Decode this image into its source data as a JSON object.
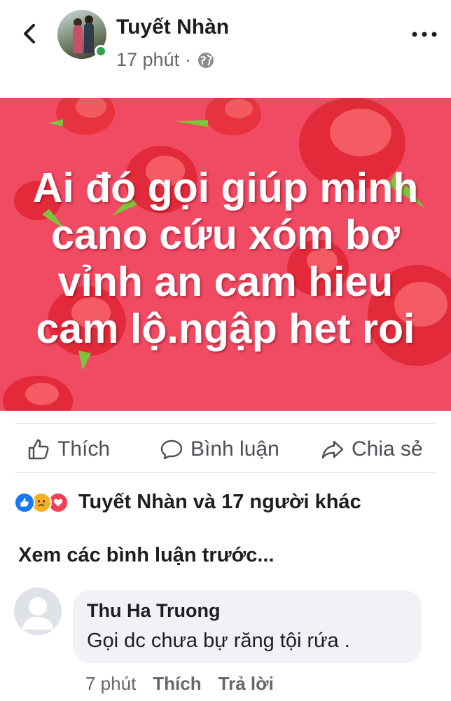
{
  "header": {
    "author": "Tuyết Nhàn",
    "time": "17 phút",
    "separator": "·",
    "icons": {
      "back": "chevron-left-icon",
      "privacy": "globe-icon",
      "more": "more-dots-icon"
    }
  },
  "post": {
    "lines": [
      "Ai đó gọi giúp minh",
      "cano cứu xóm bơ",
      "vỉnh an cam hieu",
      "cam lộ.ngập het roi"
    ],
    "background_color": "#f14a63"
  },
  "actions": {
    "like": "Thích",
    "comment": "Bình luận",
    "share": "Chia sẻ"
  },
  "reactions": {
    "icons": [
      "like-reaction-icon",
      "sad-reaction-icon",
      "love-reaction-icon"
    ],
    "summary": "Tuyết Nhàn và 17 người khác"
  },
  "comments": {
    "view_previous": "Xem các bình luận trước...",
    "items": [
      {
        "author": "Thu Ha Truong",
        "text": "Gọi dc chưa bự răng tội rứa .",
        "time": "7 phút",
        "like_label": "Thích",
        "reply_label": "Trả lời"
      }
    ]
  },
  "colors": {
    "online": "#31a24c",
    "like_blue": "#1877f2",
    "text_secondary": "#65676b"
  }
}
